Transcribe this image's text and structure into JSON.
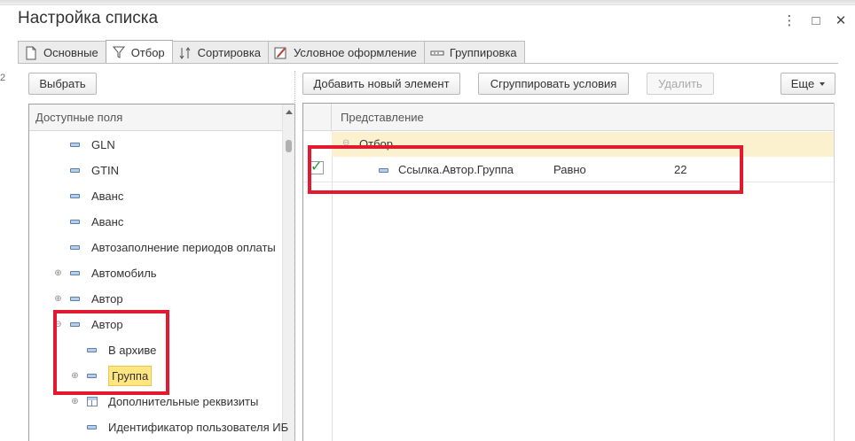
{
  "window": {
    "title": "Настройка списка",
    "controls": {
      "more_icon": "⋮",
      "maximize_icon": "□",
      "close_icon": "✕"
    },
    "edge_fragment": "2"
  },
  "tabs": [
    {
      "label": "Основные",
      "icon": "document-icon",
      "active": false
    },
    {
      "label": "Отбор",
      "icon": "filter-icon",
      "active": true
    },
    {
      "label": "Сортировка",
      "icon": "sort-icon",
      "active": false
    },
    {
      "label": "Условное оформление",
      "icon": "brush-icon",
      "active": false
    },
    {
      "label": "Группировка",
      "icon": "grouping-icon",
      "active": false
    }
  ],
  "left_panel": {
    "select_button": "Выбрать",
    "tree_header": "Доступные поля",
    "items": [
      {
        "label": "GLN",
        "expander": ""
      },
      {
        "label": "GTIN",
        "expander": ""
      },
      {
        "label": "Аванс",
        "expander": ""
      },
      {
        "label": "Аванс",
        "expander": ""
      },
      {
        "label": "Автозаполнение периодов оплаты",
        "expander": ""
      },
      {
        "label": "Автомобиль",
        "expander": "⊕"
      },
      {
        "label": "Автор",
        "expander": "⊕"
      },
      {
        "label": "Автор",
        "expander": "⊖"
      },
      {
        "label": "В архиве",
        "expander": ""
      },
      {
        "label": "Группа",
        "expander": "⊕",
        "selected": true
      },
      {
        "label": "Дополнительные реквизиты",
        "expander": "⊕"
      },
      {
        "label": "Идентификатор пользователя ИБ",
        "expander": ""
      }
    ]
  },
  "right_panel": {
    "add_button": "Добавить новый элемент",
    "group_button": "Сгруппировать условия",
    "delete_button": "Удалить",
    "more_button": "Еще",
    "column_header": "Представление",
    "group_row": {
      "expander": "⊖",
      "label": "Отбор"
    },
    "condition": {
      "checked": true,
      "check_glyph": "✓",
      "field": "Ссылка.Автор.Группа",
      "operator": "Равно",
      "value": "22"
    }
  },
  "colors": {
    "annotation_red": "#e2192f",
    "selection_yellow": "#ffe680",
    "group_row_bg": "#fbf1cf",
    "checkmark_green": "#1e9b3a"
  }
}
